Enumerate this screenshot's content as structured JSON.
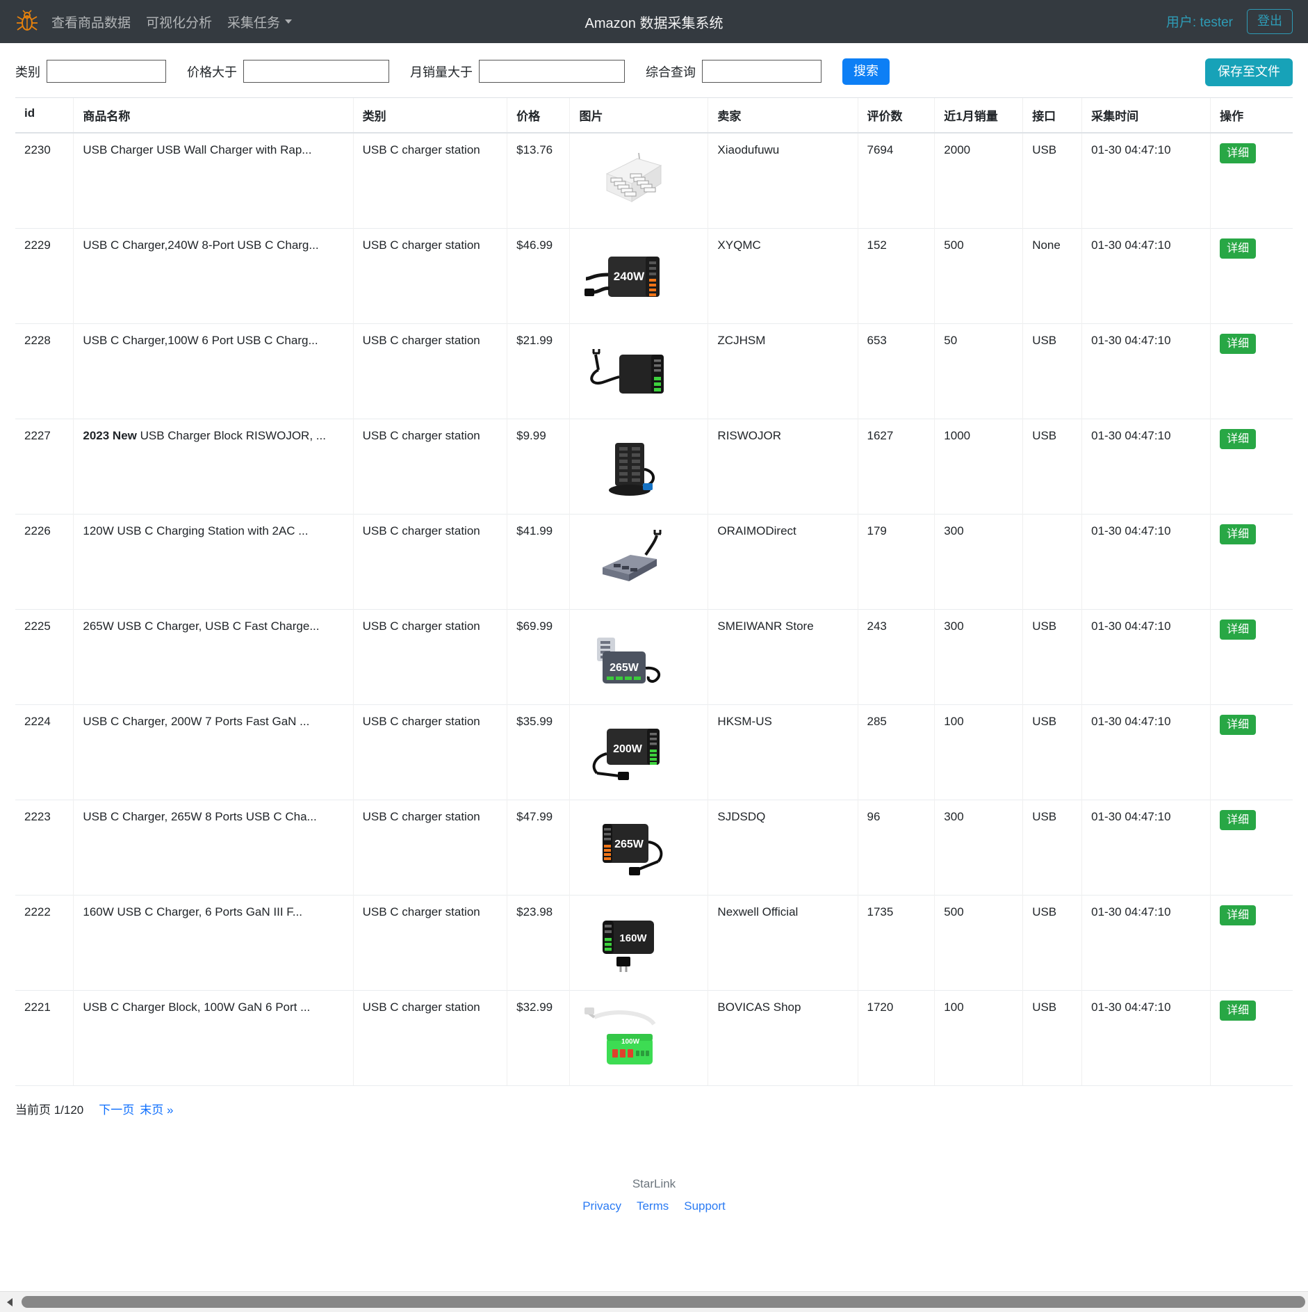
{
  "navbar": {
    "brand_icon": "bug-logo-icon",
    "links": [
      {
        "label": "查看商品数据",
        "name": "nav-view-product-data"
      },
      {
        "label": "可视化分析",
        "name": "nav-visual-analysis"
      },
      {
        "label": "采集任务",
        "name": "nav-collect-task"
      }
    ],
    "title": "Amazon 数据采集系统",
    "user_label": "用户: tester",
    "logout_label": "登出",
    "bg_color": "#343a40",
    "accent_color": "#2e9bb5"
  },
  "filterbar": {
    "fields": [
      {
        "label": "类别",
        "value": "",
        "placeholder": "",
        "name": "category-input"
      },
      {
        "label": "价格大于",
        "value": "",
        "placeholder": "",
        "name": "price-greater-input"
      },
      {
        "label": "月销量大于",
        "value": "",
        "placeholder": "",
        "name": "monthly-sales-greater-input"
      },
      {
        "label": "综合查询",
        "value": "",
        "placeholder": "",
        "name": "combined-query-input"
      }
    ],
    "search_label": "搜索",
    "save_label": "保存至文件",
    "search_color": "#0d7ff5",
    "save_color": "#17a2b8"
  },
  "table": {
    "columns": [
      "id",
      "商品名称",
      "类别",
      "价格",
      "图片",
      "卖家",
      "评价数",
      "近1月销量",
      "接口",
      "采集时间",
      "操作"
    ],
    "action_label": "详细",
    "action_color": "#28a745",
    "rows": [
      {
        "id": "2230",
        "name_bold": "",
        "name": "USB Charger USB Wall Charger with Rap...",
        "category": "USB C charger station",
        "price": "$13.76",
        "image": "white-10-port-usb-charging-station",
        "seller": "Xiaodufuwu",
        "reviews": "7694",
        "sales": "2000",
        "api": "USB",
        "time": "01-30 04:47:10"
      },
      {
        "id": "2229",
        "name_bold": "",
        "name": "USB C Charger,240W 8-Port USB C Charg...",
        "category": "USB C charger station",
        "price": "$46.99",
        "image": "black-240w-charger-with-cable",
        "seller": "XYQMC",
        "reviews": "152",
        "sales": "500",
        "api": "None",
        "time": "01-30 04:47:10"
      },
      {
        "id": "2228",
        "name_bold": "",
        "name": "USB C Charger,100W 6 Port USB C Charg...",
        "category": "USB C charger station",
        "price": "$21.99",
        "image": "black-100w-6-port-charger-coiled-cable",
        "seller": "ZCJHSM",
        "reviews": "653",
        "sales": "50",
        "api": "USB",
        "time": "01-30 04:47:10"
      },
      {
        "id": "2227",
        "name_bold": "2023 New",
        "name": " USB Charger Block RISWOJOR, ...",
        "category": "USB C charger station",
        "price": "$9.99",
        "image": "black-tower-charging-station-blue-plug",
        "seller": "RISWOJOR",
        "reviews": "1627",
        "sales": "1000",
        "api": "USB",
        "time": "01-30 04:47:10"
      },
      {
        "id": "2226",
        "name_bold": "",
        "name": "120W USB C Charging Station with 2AC ...",
        "category": "USB C charger station",
        "price": "$41.99",
        "image": "grey-slim-charging-station-with-cord",
        "seller": "ORAIMODirect",
        "reviews": "179",
        "sales": "300",
        "api": "",
        "time": "01-30 04:47:10"
      },
      {
        "id": "2225",
        "name_bold": "",
        "name": "265W USB C Charger, USB C Fast Charge...",
        "category": "USB C charger station",
        "price": "$69.99",
        "image": "grey-265w-charger-with-ports",
        "seller": "SMEIWANR Store",
        "reviews": "243",
        "sales": "300",
        "api": "USB",
        "time": "01-30 04:47:10"
      },
      {
        "id": "2224",
        "name_bold": "",
        "name": "USB C Charger, 200W 7 Ports Fast GaN ...",
        "category": "USB C charger station",
        "price": "$35.99",
        "image": "black-200w-gan-charger",
        "seller": "HKSM-US",
        "reviews": "285",
        "sales": "100",
        "api": "USB",
        "time": "01-30 04:47:10"
      },
      {
        "id": "2223",
        "name_bold": "",
        "name": "USB C Charger, 265W 8 Ports USB C Cha...",
        "category": "USB C charger station",
        "price": "$47.99",
        "image": "black-265w-8-port-charger",
        "seller": "SJDSDQ",
        "reviews": "96",
        "sales": "300",
        "api": "USB",
        "time": "01-30 04:47:10"
      },
      {
        "id": "2222",
        "name_bold": "",
        "name": "160W USB C Charger, 6 Ports GaN III F...",
        "category": "USB C charger station",
        "price": "$23.98",
        "image": "black-160w-gan-charger",
        "seller": "Nexwell Official",
        "reviews": "1735",
        "sales": "500",
        "api": "USB",
        "time": "01-30 04:47:10"
      },
      {
        "id": "2221",
        "name_bold": "",
        "name": "USB C Charger Block, 100W GaN 6 Port ...",
        "category": "USB C charger station",
        "price": "$32.99",
        "image": "green-100w-charger-with-white-cable",
        "seller": "BOVICAS Shop",
        "reviews": "1720",
        "sales": "100",
        "api": "USB",
        "time": "01-30 04:47:10"
      }
    ]
  },
  "pagination": {
    "current_text": "当前页 1/120",
    "next_label": "下一页",
    "last_label": "末页 »"
  },
  "footer": {
    "brand": "StarLink",
    "links": [
      "Privacy",
      "Terms",
      "Support"
    ]
  },
  "scrollbar": {
    "left_arrow": "scroll-left-arrow-icon"
  }
}
